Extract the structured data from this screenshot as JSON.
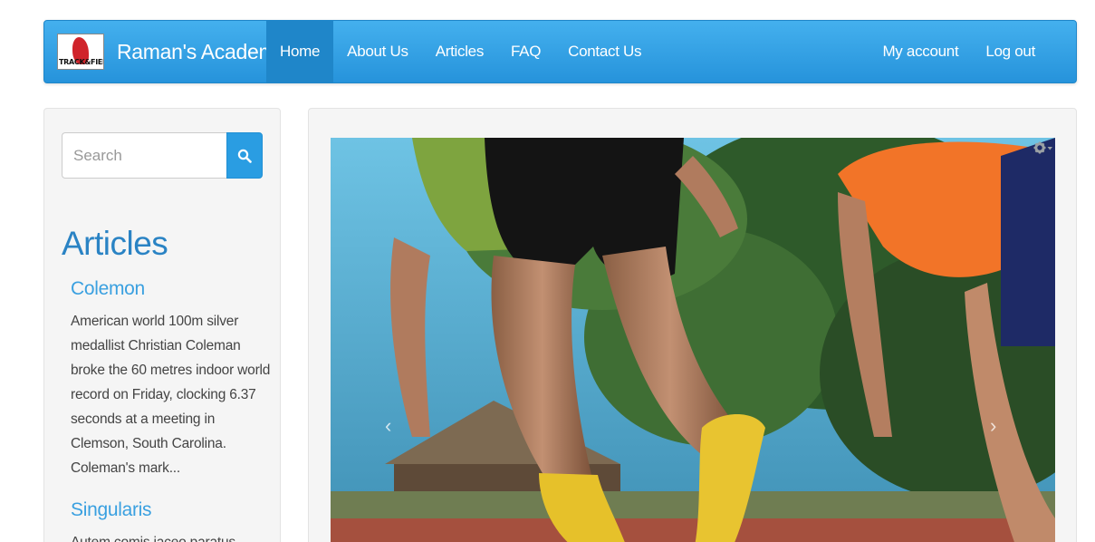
{
  "brand": {
    "name": "Raman's Academy",
    "logo_text": "TRACK&FIELD"
  },
  "nav": {
    "left": [
      "Home",
      "About Us",
      "Articles",
      "FAQ",
      "Contact Us"
    ],
    "right": [
      "My account",
      "Log out"
    ]
  },
  "search": {
    "placeholder": "Search"
  },
  "sidebar": {
    "heading": "Articles",
    "articles": [
      {
        "title": "Colemon",
        "body": "American world 100m silver medallist Christian Coleman broke the 60 metres indoor world record on Friday, clocking 6.37 seconds at a meeting in Clemson, South Carolina.",
        "more": "Coleman's mark..."
      },
      {
        "title": "Singularis",
        "body": "Autem comis iaceo paratus"
      }
    ]
  },
  "carousel": {
    "prev": "‹",
    "next": "›"
  },
  "colors": {
    "navbar": "#2a9de2",
    "active": "#1f86c9",
    "heading": "#2a83c4",
    "link": "#3aa0e0"
  },
  "icons": [
    "search-icon",
    "gear-icon",
    "chevron-left-icon",
    "chevron-right-icon"
  ]
}
